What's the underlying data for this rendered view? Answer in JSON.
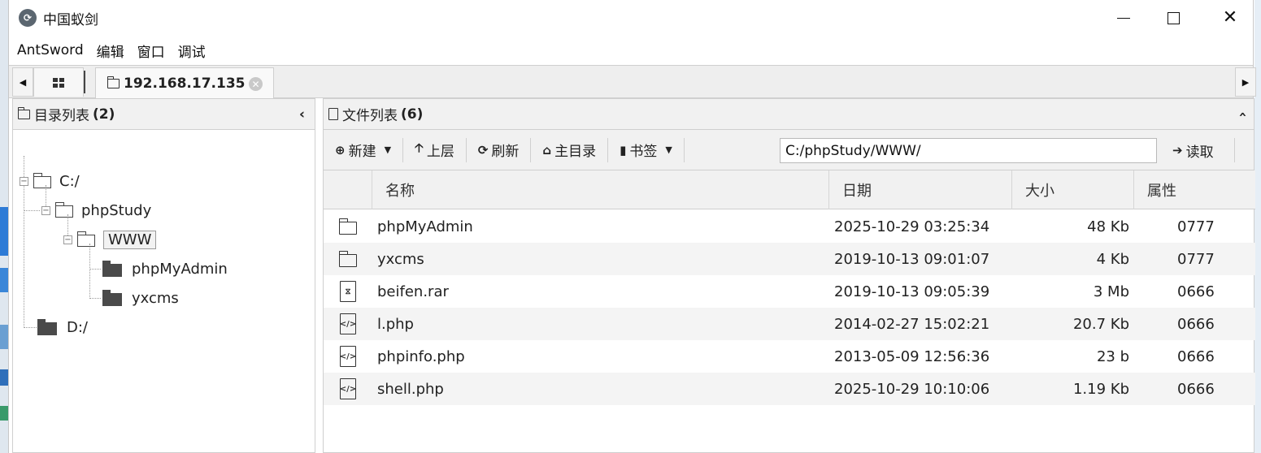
{
  "window": {
    "title": "中国蚁剑",
    "app_icon": "antsword-logo-icon"
  },
  "menu": [
    "AntSword",
    "编辑",
    "窗口",
    "调试"
  ],
  "tabs": {
    "host": "192.168.17.135"
  },
  "left_panel": {
    "title": "目录列表",
    "count": "(2)",
    "tree": [
      {
        "label": "C:/",
        "depth": 0,
        "type": "folder-open"
      },
      {
        "label": "phpStudy",
        "depth": 1,
        "type": "folder-open"
      },
      {
        "label": "WWW",
        "depth": 2,
        "type": "folder-open",
        "selected": true
      },
      {
        "label": "phpMyAdmin",
        "depth": 3,
        "type": "folder-closed"
      },
      {
        "label": "yxcms",
        "depth": 3,
        "type": "folder-closed"
      },
      {
        "label": "D:/",
        "depth": 0,
        "type": "folder-closed"
      }
    ]
  },
  "right_panel": {
    "title": "文件列表",
    "count": "(6)",
    "toolbar": {
      "new": "新建",
      "up": "上层",
      "refresh": "刷新",
      "home": "主目录",
      "bookmark": "书签",
      "path": "C:/phpStudy/WWW/",
      "read": "读取"
    },
    "columns": [
      "名称",
      "日期",
      "大小",
      "属性"
    ],
    "files": [
      {
        "icon": "folder-icon",
        "name": "phpMyAdmin",
        "date": "2025-10-29 03:25:34",
        "size": "48 Kb",
        "attr": "0777"
      },
      {
        "icon": "folder-icon",
        "name": "yxcms",
        "date": "2019-10-13 09:01:07",
        "size": "4 Kb",
        "attr": "0777"
      },
      {
        "icon": "archive-file-icon",
        "name": "beifen.rar",
        "date": "2019-10-13 09:05:39",
        "size": "3 Mb",
        "attr": "0666"
      },
      {
        "icon": "code-file-icon",
        "name": "l.php",
        "date": "2014-02-27 15:02:21",
        "size": "20.7 Kb",
        "attr": "0666"
      },
      {
        "icon": "code-file-icon",
        "name": "phpinfo.php",
        "date": "2013-05-09 12:56:36",
        "size": "23 b",
        "attr": "0666"
      },
      {
        "icon": "code-file-icon",
        "name": "shell.php",
        "date": "2025-10-29 10:10:06",
        "size": "1.19 Kb",
        "attr": "0666"
      }
    ]
  }
}
